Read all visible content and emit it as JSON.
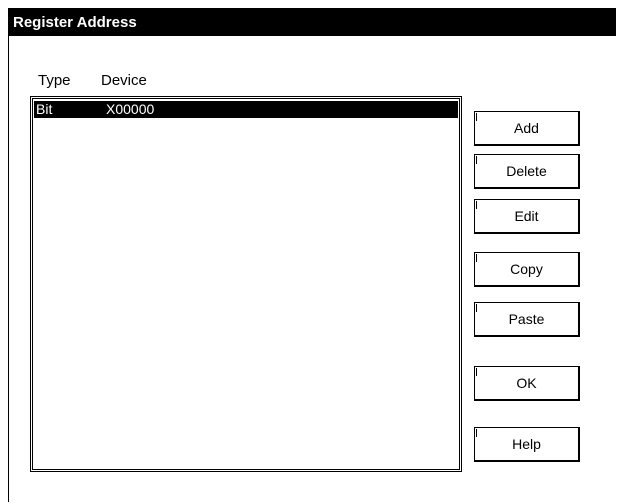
{
  "window": {
    "title": "Register Address"
  },
  "list": {
    "columns": [
      "Type",
      "Device"
    ],
    "rows": [
      {
        "type": "Bit",
        "device": "X00000",
        "selected": true
      }
    ]
  },
  "buttons": {
    "add": "Add",
    "delete": "Delete",
    "edit": "Edit",
    "copy": "Copy",
    "paste": "Paste",
    "ok": "OK",
    "help": "Help"
  }
}
